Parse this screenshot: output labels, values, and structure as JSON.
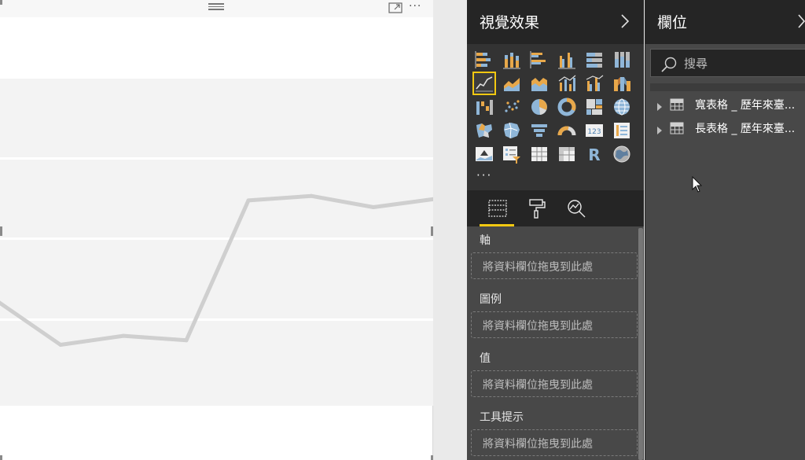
{
  "visual_header": {
    "drag_icon": "drag-handle-icon",
    "focus_icon": "focus-mode-icon",
    "more_label": "···"
  },
  "chart_data": {
    "type": "line",
    "title": "",
    "xlabel": "",
    "ylabel": "",
    "series": [
      {
        "name": "",
        "color": "#cfcfcf",
        "values": [
          46,
          27,
          31,
          29,
          91,
          93,
          88,
          92
        ]
      }
    ],
    "ylim": [
      0,
      145
    ],
    "gridlines": [
      30,
      76,
      122
    ],
    "grid": true,
    "legend": "none"
  },
  "visualizations": {
    "title": "視覺效果",
    "collapse_icon": "chevron-right-icon",
    "more_label": "···",
    "selected": "line-chart-icon",
    "icons": [
      "stacked-bar-chart-icon",
      "stacked-column-chart-icon",
      "clustered-bar-chart-icon",
      "clustered-column-chart-icon",
      "100-stacked-bar-chart-icon",
      "100-stacked-column-chart-icon",
      "line-chart-icon",
      "area-chart-icon",
      "stacked-area-chart-icon",
      "line-and-stacked-column-chart-icon",
      "line-and-clustered-column-chart-icon",
      "ribbon-chart-icon",
      "waterfall-chart-icon",
      "scatter-chart-icon",
      "pie-chart-icon",
      "donut-chart-icon",
      "treemap-icon",
      "map-icon",
      "filled-map-icon",
      "shape-map-icon",
      "funnel-icon",
      "gauge-icon",
      "card-icon",
      "multi-row-card-icon",
      "kpi-icon",
      "slicer-icon",
      "table-icon",
      "matrix-icon",
      "r-visual-icon",
      "arcgis-map-icon"
    ],
    "tabs": [
      {
        "name": "fields-tab",
        "icon": "fields-icon"
      },
      {
        "name": "format-tab",
        "icon": "paint-roller-icon"
      },
      {
        "name": "analytics-tab",
        "icon": "analytics-icon"
      }
    ],
    "wells": [
      {
        "label": "軸",
        "placeholder": "將資料欄位拖曳到此處"
      },
      {
        "label": "圖例",
        "placeholder": "將資料欄位拖曳到此處"
      },
      {
        "label": "值",
        "placeholder": "將資料欄位拖曳到此處"
      },
      {
        "label": "工具提示",
        "placeholder": "將資料欄位拖曳到此處"
      }
    ]
  },
  "fields": {
    "title": "欄位",
    "collapse_icon": "chevron-right-icon",
    "search": {
      "placeholder": "搜尋",
      "icon": "search-icon"
    },
    "tables": [
      {
        "name": "寬表格 _ 歷年來臺...",
        "icon": "table-icon"
      },
      {
        "name": "長表格 _ 歷年來臺...",
        "icon": "table-icon"
      }
    ]
  },
  "colors": {
    "accent": "#f2c811",
    "pane_bg": "#484848",
    "header_bg": "#252525",
    "gallery_bg": "#333333"
  }
}
